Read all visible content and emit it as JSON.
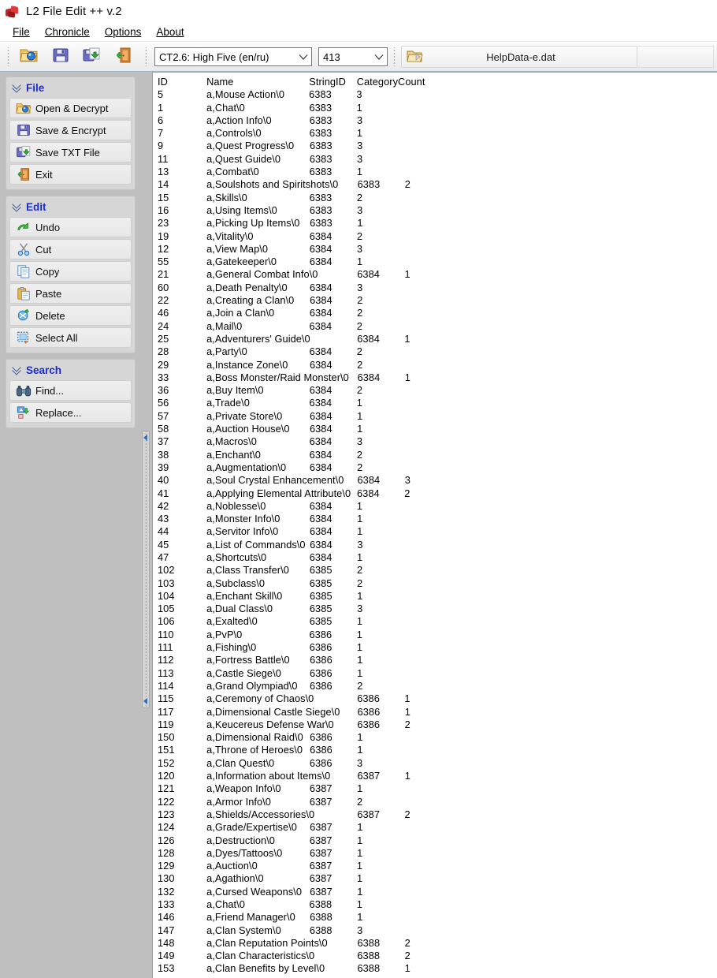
{
  "window": {
    "title": "L2 File Edit ++ v.2",
    "icon": "app-cubes-icon"
  },
  "menu": {
    "items": [
      {
        "label": "File",
        "accel": "F"
      },
      {
        "label": "Chronicle",
        "accel": "C"
      },
      {
        "label": "Options",
        "accel": "O"
      },
      {
        "label": "About",
        "accel": "A"
      }
    ]
  },
  "toolbar": {
    "buttons": [
      {
        "name": "open-decrypt",
        "icon": "folder-open-icon"
      },
      {
        "name": "save-encrypt",
        "icon": "floppy-disk-icon"
      },
      {
        "name": "save-txt",
        "icon": "floppy-export-icon"
      },
      {
        "name": "exit",
        "icon": "door-exit-icon"
      }
    ],
    "chronicle_combo": {
      "value": "CT2.6: High Five (en/ru)",
      "options": [
        "CT2.6: High Five (en/ru)"
      ]
    },
    "code_combo": {
      "value": "413",
      "options": [
        "413"
      ]
    },
    "file": {
      "icon": "file-dat-icon",
      "name": "HelpData-e.dat"
    }
  },
  "sidebar": {
    "groups": [
      {
        "title": "File",
        "items": [
          {
            "label": "Open & Decrypt",
            "icon": "folder-open-icon"
          },
          {
            "label": "Save & Encrypt",
            "icon": "floppy-disk-icon"
          },
          {
            "label": "Save TXT File",
            "icon": "floppy-export-icon"
          },
          {
            "label": "Exit",
            "icon": "door-exit-icon"
          }
        ]
      },
      {
        "title": "Edit",
        "items": [
          {
            "label": "Undo",
            "icon": "undo-arrow-icon"
          },
          {
            "label": "Cut",
            "icon": "scissors-icon"
          },
          {
            "label": "Copy",
            "icon": "copy-pages-icon"
          },
          {
            "label": "Paste",
            "icon": "clipboard-paste-icon"
          },
          {
            "label": "Delete",
            "icon": "delete-icon"
          },
          {
            "label": "Select All",
            "icon": "select-all-icon"
          }
        ]
      },
      {
        "title": "Search",
        "items": [
          {
            "label": "Find...",
            "icon": "binoculars-icon"
          },
          {
            "label": "Replace...",
            "icon": "replace-icon"
          }
        ]
      }
    ]
  },
  "editor": {
    "header": {
      "id": "ID",
      "name": "Name",
      "stringid": "StringID",
      "category": "Category",
      "count": "Count"
    },
    "rows": [
      {
        "id": "5",
        "name": "a,Mouse Action\\0",
        "stringid": "6383",
        "count": "3"
      },
      {
        "id": "1",
        "name": "a,Chat\\0",
        "stringid": "6383",
        "count": "1"
      },
      {
        "id": "6",
        "name": "a,Action Info\\0",
        "stringid": "6383",
        "count": "3"
      },
      {
        "id": "7",
        "name": "a,Controls\\0",
        "stringid": "6383",
        "count": "1"
      },
      {
        "id": "9",
        "name": "a,Quest Progress\\0",
        "stringid": "6383",
        "count": "3"
      },
      {
        "id": "11",
        "name": "a,Quest Guide\\0",
        "stringid": "6383",
        "count": "3"
      },
      {
        "id": "13",
        "name": "a,Combat\\0",
        "stringid": "6383",
        "count": "1"
      },
      {
        "id": "14",
        "name": "a,Soulshots and Spiritshots\\0",
        "stringid": "6383",
        "count": "2"
      },
      {
        "id": "15",
        "name": "a,Skills\\0",
        "stringid": "6383",
        "count": "2"
      },
      {
        "id": "16",
        "name": "a,Using Items\\0",
        "stringid": "6383",
        "count": "3"
      },
      {
        "id": "23",
        "name": "a,Picking Up Items\\0",
        "stringid": "6383",
        "count": "1"
      },
      {
        "id": "19",
        "name": "a,Vitality\\0",
        "stringid": "6384",
        "count": "2"
      },
      {
        "id": "12",
        "name": "a,View Map\\0",
        "stringid": "6384",
        "count": "3"
      },
      {
        "id": "55",
        "name": "a,Gatekeeper\\0",
        "stringid": "6384",
        "count": "1"
      },
      {
        "id": "21",
        "name": "a,General Combat Info\\0",
        "stringid": "6384",
        "count": "1"
      },
      {
        "id": "60",
        "name": "a,Death Penalty\\0",
        "stringid": "6384",
        "count": "3"
      },
      {
        "id": "22",
        "name": "a,Creating a Clan\\0",
        "stringid": "6384",
        "count": "2"
      },
      {
        "id": "46",
        "name": "a,Join a Clan\\0",
        "stringid": "6384",
        "count": "2"
      },
      {
        "id": "24",
        "name": "a,Mail\\0",
        "stringid": "6384",
        "count": "2"
      },
      {
        "id": "25",
        "name": "a,Adventurers' Guide\\0",
        "stringid": "6384",
        "count": "1"
      },
      {
        "id": "28",
        "name": "a,Party\\0",
        "stringid": "6384",
        "count": "2"
      },
      {
        "id": "29",
        "name": "a,Instance Zone\\0",
        "stringid": "6384",
        "count": "2"
      },
      {
        "id": "33",
        "name": "a,Boss Monster/Raid Monster\\0",
        "stringid": "6384",
        "count": "1"
      },
      {
        "id": "36",
        "name": "a,Buy Item\\0",
        "stringid": "6384",
        "count": "2"
      },
      {
        "id": "56",
        "name": "a,Trade\\0",
        "stringid": "6384",
        "count": "1"
      },
      {
        "id": "57",
        "name": "a,Private Store\\0",
        "stringid": "6384",
        "count": "1"
      },
      {
        "id": "58",
        "name": "a,Auction House\\0",
        "stringid": "6384",
        "count": "1"
      },
      {
        "id": "37",
        "name": "a,Macros\\0",
        "stringid": "6384",
        "count": "3"
      },
      {
        "id": "38",
        "name": "a,Enchant\\0",
        "stringid": "6384",
        "count": "2"
      },
      {
        "id": "39",
        "name": "a,Augmentation\\0",
        "stringid": "6384",
        "count": "2"
      },
      {
        "id": "40",
        "name": "a,Soul Crystal Enhancement\\0",
        "stringid": "6384",
        "count": "3"
      },
      {
        "id": "41",
        "name": "a,Applying Elemental Attribute\\0",
        "stringid": "6384",
        "count": "2"
      },
      {
        "id": "42",
        "name": "a,Noblesse\\0",
        "stringid": "6384",
        "count": "1"
      },
      {
        "id": "43",
        "name": "a,Monster Info\\0",
        "stringid": "6384",
        "count": "1"
      },
      {
        "id": "44",
        "name": "a,Servitor Info\\0",
        "stringid": "6384",
        "count": "1"
      },
      {
        "id": "45",
        "name": "a,List of Commands\\0",
        "stringid": "6384",
        "count": "3"
      },
      {
        "id": "47",
        "name": "a,Shortcuts\\0",
        "stringid": "6384",
        "count": "1"
      },
      {
        "id": "102",
        "name": "a,Class Transfer\\0",
        "stringid": "6385",
        "count": "2"
      },
      {
        "id": "103",
        "name": "a,Subclass\\0",
        "stringid": "6385",
        "count": "2"
      },
      {
        "id": "104",
        "name": "a,Enchant Skill\\0",
        "stringid": "6385",
        "count": "1"
      },
      {
        "id": "105",
        "name": "a,Dual Class\\0",
        "stringid": "6385",
        "count": "3"
      },
      {
        "id": "106",
        "name": "a,Exalted\\0",
        "stringid": "6385",
        "count": "1"
      },
      {
        "id": "110",
        "name": "a,PvP\\0",
        "stringid": "6386",
        "count": "1"
      },
      {
        "id": "111",
        "name": "a,Fishing\\0",
        "stringid": "6386",
        "count": "1"
      },
      {
        "id": "112",
        "name": "a,Fortress Battle\\0",
        "stringid": "6386",
        "count": "1"
      },
      {
        "id": "113",
        "name": "a,Castle Siege\\0",
        "stringid": "6386",
        "count": "1"
      },
      {
        "id": "114",
        "name": "a,Grand Olympiad\\0",
        "stringid": "6386",
        "count": "2"
      },
      {
        "id": "115",
        "name": "a,Ceremony of Chaos\\0",
        "stringid": "6386",
        "count": "1"
      },
      {
        "id": "117",
        "name": "a,Dimensional Castle Siege\\0",
        "stringid": "6386",
        "count": "1"
      },
      {
        "id": "119",
        "name": "a,Keucereus Defense War\\0",
        "stringid": "6386",
        "count": "2"
      },
      {
        "id": "150",
        "name": "a,Dimensional Raid\\0",
        "stringid": "6386",
        "count": "1"
      },
      {
        "id": "151",
        "name": "a,Throne of Heroes\\0",
        "stringid": "6386",
        "count": "1"
      },
      {
        "id": "152",
        "name": "a,Clan Quest\\0",
        "stringid": "6386",
        "count": "3"
      },
      {
        "id": "120",
        "name": "a,Information about Items\\0",
        "stringid": "6387",
        "count": "1"
      },
      {
        "id": "121",
        "name": "a,Weapon Info\\0",
        "stringid": "6387",
        "count": "1"
      },
      {
        "id": "122",
        "name": "a,Armor Info\\0",
        "stringid": "6387",
        "count": "2"
      },
      {
        "id": "123",
        "name": "a,Shields/Accessories\\0",
        "stringid": "6387",
        "count": "2"
      },
      {
        "id": "124",
        "name": "a,Grade/Expertise\\0",
        "stringid": "6387",
        "count": "1"
      },
      {
        "id": "126",
        "name": "a,Destruction\\0",
        "stringid": "6387",
        "count": "1"
      },
      {
        "id": "128",
        "name": "a,Dyes/Tattoos\\0",
        "stringid": "6387",
        "count": "1"
      },
      {
        "id": "129",
        "name": "a,Auction\\0",
        "stringid": "6387",
        "count": "1"
      },
      {
        "id": "130",
        "name": "a,Agathion\\0",
        "stringid": "6387",
        "count": "1"
      },
      {
        "id": "132",
        "name": "a,Cursed Weapons\\0",
        "stringid": "6387",
        "count": "1"
      },
      {
        "id": "133",
        "name": "a,Chat\\0",
        "stringid": "6388",
        "count": "1"
      },
      {
        "id": "146",
        "name": "a,Friend Manager\\0",
        "stringid": "6388",
        "count": "1"
      },
      {
        "id": "147",
        "name": "a,Clan System\\0",
        "stringid": "6388",
        "count": "3"
      },
      {
        "id": "148",
        "name": "a,Clan Reputation Points\\0",
        "stringid": "6388",
        "count": "2"
      },
      {
        "id": "149",
        "name": "a,Clan Characteristics\\0",
        "stringid": "6388",
        "count": "2"
      },
      {
        "id": "153",
        "name": "a,Clan Benefits by Level\\0",
        "stringid": "6388",
        "count": "1"
      }
    ]
  },
  "colors": {
    "panel_title": "#1b2ccc",
    "sidebar_bg": "#bfbfbf",
    "editor_border": "#7aa8d0",
    "toolbar_border": "#9fb5c9"
  }
}
